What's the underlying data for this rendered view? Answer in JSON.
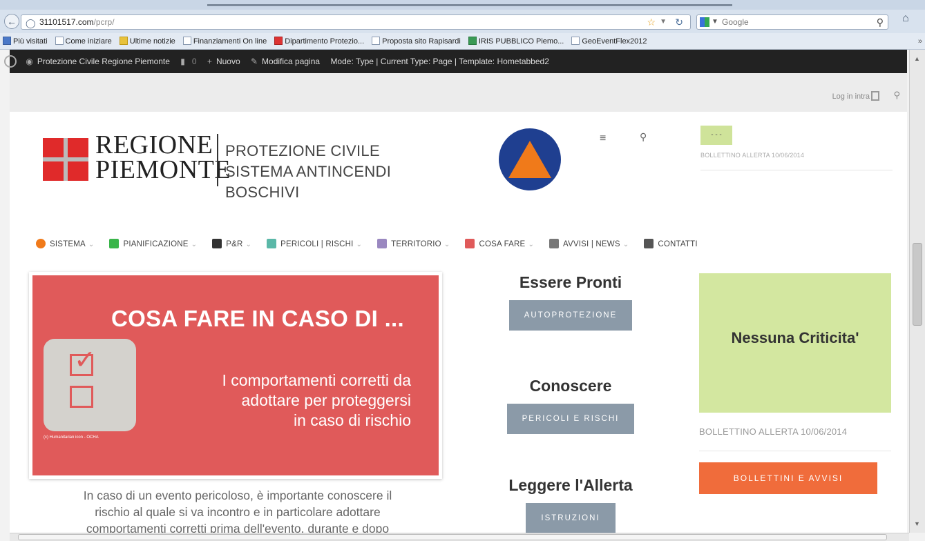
{
  "browser": {
    "url_domain": "31101517.com",
    "url_path": "/pcrp/",
    "search_placeholder": "Google",
    "bookmarks": [
      {
        "label": "Più visitati",
        "icon": "blue"
      },
      {
        "label": "Come iniziare",
        "icon": "white"
      },
      {
        "label": "Ultime notizie",
        "icon": "yellow"
      },
      {
        "label": "Finanziamenti On line",
        "icon": "white"
      },
      {
        "label": "Dipartimento Protezio...",
        "icon": "red"
      },
      {
        "label": "Proposta sito Rapisardi",
        "icon": "white"
      },
      {
        "label": "IRIS PUBBLICO Piemo...",
        "icon": "green"
      },
      {
        "label": "GeoEventFlex2012",
        "icon": "white"
      }
    ],
    "more": "»"
  },
  "adminbar": {
    "site": "Protezione Civile Regione Piemonte",
    "comments": "0",
    "new": "Nuovo",
    "edit": "Modifica pagina",
    "mode": "Mode: Type | Current Type: Page | Template: Hometabbed2"
  },
  "topbar": {
    "login": "Log in intra"
  },
  "logo": {
    "region_line1": "REGIONE",
    "region_line2": "PIEMONTE",
    "sub_line1": "PROTEZIONE CIVILE",
    "sub_line2": "SISTEMA ANTINCENDI BOSCHIVI"
  },
  "header_bollettino": {
    "swatch_text": "- - -",
    "caption": "BOLLETTINO ALLERTA 10/06/2014"
  },
  "nav": [
    {
      "label": "SISTEMA",
      "color": "#f07a1a",
      "caret": true
    },
    {
      "label": "PIANIFICAZIONE",
      "color": "#3ab54a",
      "caret": true
    },
    {
      "label": "P&R",
      "color": "#333333",
      "caret": true
    },
    {
      "label": "PERICOLI | RISCHI",
      "color": "#5bb8a8",
      "caret": true
    },
    {
      "label": "TERRITORIO",
      "color": "#9a88c0",
      "caret": true
    },
    {
      "label": "COSA FARE",
      "color": "#e05a5a",
      "caret": true
    },
    {
      "label": "AVVISI | NEWS",
      "color": "#777777",
      "caret": true
    },
    {
      "label": "CONTATTI",
      "color": "#555555",
      "caret": false
    }
  ],
  "hero": {
    "title": "COSA FARE IN CASO DI ...",
    "subtitle_line1": "I comportamenti corretti da",
    "subtitle_line2": "adottare per proteggersi",
    "subtitle_line3": "in caso di rischio",
    "credit": "(c) Humanitarian icon - OCHA",
    "caption_line1": "In caso di un evento pericoloso, è importante conoscere il",
    "caption_line2": "rischio al quale si va incontro e in particolare adottare",
    "caption_line3": "comportamenti corretti prima dell'evento, durante e dopo"
  },
  "sections": [
    {
      "title": "Essere Pronti",
      "button": "AUTOPROTEZIONE"
    },
    {
      "title": "Conoscere",
      "button": "PERICOLI E RISCHI"
    },
    {
      "title": "Leggere l'Allerta",
      "button": "ISTRUZIONI"
    }
  ],
  "status": {
    "criticita": "Nessuna Criticita'",
    "bollettino": "BOLLETTINO ALLERTA 10/06/2014",
    "button": "BOLLETTINI E AVVISI"
  },
  "colors": {
    "accent_red": "#e05a5a",
    "green_status": "#d3e7a0",
    "orange_button": "#f06c3b",
    "section_button": "#8b9aa8"
  }
}
